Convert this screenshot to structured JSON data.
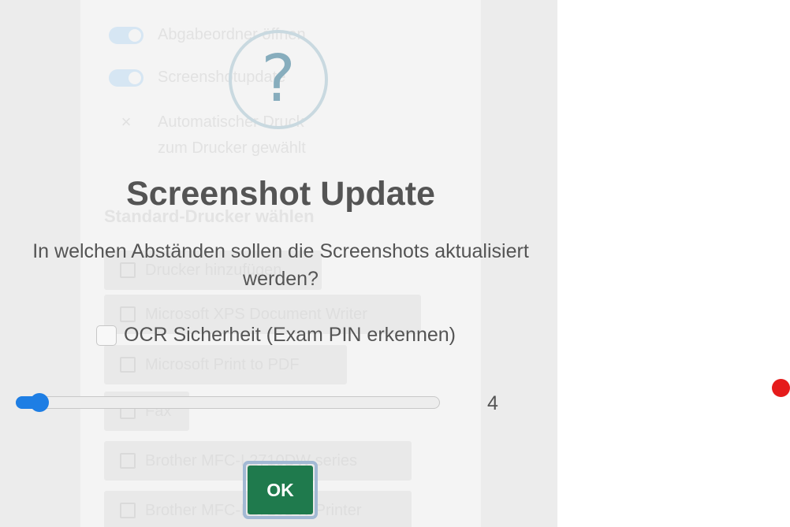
{
  "background": {
    "settings": [
      {
        "kind": "toggle",
        "label": "Abgabeordner öffnen"
      },
      {
        "kind": "toggle",
        "label": "Screenshotupdate"
      },
      {
        "kind": "x",
        "label": "Automatischer Druck"
      },
      {
        "kind": "none",
        "label": "zum Drucker gewählt"
      }
    ],
    "printer_heading": "Standard-Drucker wählen",
    "printers": [
      "Drucker hinzufügen",
      "Microsoft XPS Document Writer",
      "Microsoft Print to PDF",
      "Fax",
      "Brother MFC-L2710DW series",
      "Brother MFC-L2710DW Printer"
    ]
  },
  "modal": {
    "icon": "question-icon",
    "icon_glyph": "?",
    "title": "Screenshot Update",
    "text": "In welchen Abständen sollen die Screenshots aktualisiert werden?",
    "ocr_label": "OCR Sicherheit (Exam PIN erkennen)",
    "ocr_checked": false,
    "slider": {
      "value": "4",
      "fraction": 0.055
    },
    "ok_label": "OK"
  },
  "colors": {
    "accent": "#1e7ee4",
    "ok_button": "#1f7a4d",
    "record_indicator": "#e51b1b"
  }
}
